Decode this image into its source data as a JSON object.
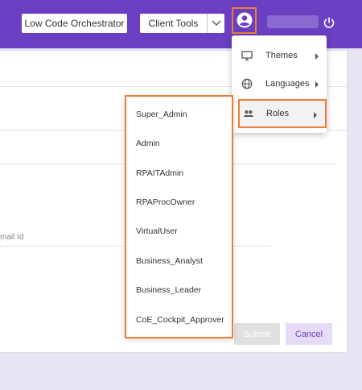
{
  "header": {
    "low_code_button": "Low Code Orchestrator",
    "client_tools_button": "Client Tools"
  },
  "form": {
    "email_placeholder": "mail Id",
    "submit_label": "Submit",
    "cancel_label": "Cancel"
  },
  "user_menu": {
    "themes_label": "Themes",
    "languages_label": "Languages",
    "roles_label": "Roles"
  },
  "roles": [
    "Super_Admin",
    "Admin",
    "RPAITAdmin",
    "RPAProcOwner",
    "VirtualUser",
    "Business_Analyst",
    "Business_Leader",
    "CoE_Cockpit_Approver"
  ],
  "colors": {
    "primary": "#6a3fc1",
    "highlight": "#ef7d3a"
  }
}
